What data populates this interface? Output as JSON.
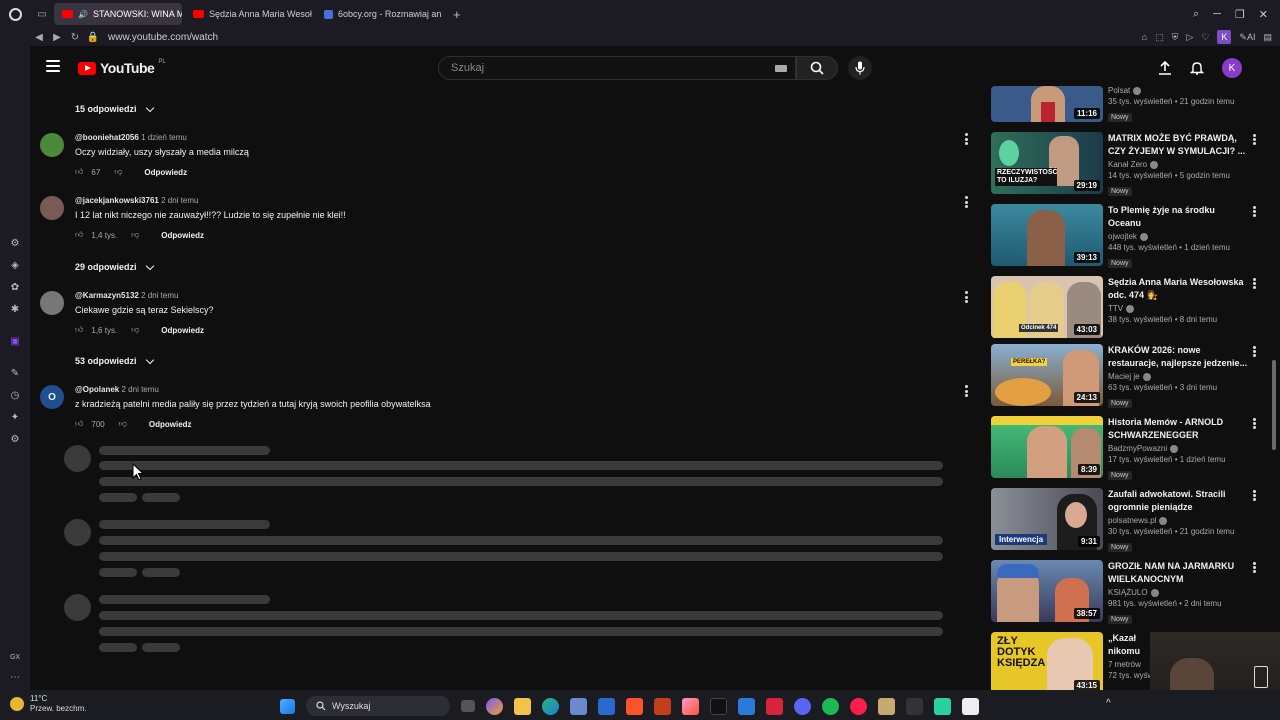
{
  "browser": {
    "tabs": [
      {
        "label": "STANOWSKI: WINA M",
        "active": true,
        "favicon_color": "#ff0000"
      },
      {
        "label": "Sędzia Anna Maria Wesoł",
        "active": false,
        "favicon_color": "#ff0000"
      },
      {
        "label": "6obcy.org - Rozmawiaj an",
        "active": false,
        "favicon_color": "#4a6fd8"
      }
    ],
    "url": "www.youtube.com/watch",
    "profile_letter": "K",
    "ai_label": "AI"
  },
  "header": {
    "logo_text": "YouTube",
    "region": "PL",
    "search_placeholder": "Szukaj",
    "avatar_letter": "K"
  },
  "comments": [
    {
      "replies_before": "15 odpowiedzi",
      "author": "@booniehat2056",
      "time": "1 dzień temu",
      "text": "Oczy widziały, uszy słyszały a media milczą",
      "likes": "67",
      "reply_label": "Odpowiedz",
      "avatar_color": "#4a8a3a"
    },
    {
      "author": "@jacekjankowski3761",
      "time": "2 dni temu",
      "text": "I 12 lat nikt niczego nie zauważył!!?? Ludzie to się zupełnie nie klei!!",
      "likes": "1,4 tys.",
      "reply_label": "Odpowiedz",
      "avatar_color": "#7a5a55"
    },
    {
      "replies_before": "29 odpowiedzi",
      "author": "@Karmazyn5132",
      "time": "2 dni temu",
      "text": "Ciekawe gdzie są teraz Sekielscy?",
      "likes": "1,6 tys.",
      "reply_label": "Odpowiedz",
      "avatar_color": "#777777"
    },
    {
      "replies_before": "53 odpowiedzi",
      "author": "@Opolanek",
      "time": "2 dni temu",
      "text": "z kradzieżą patelni media paliły się przez tydzień a tutaj kryją swoich peofilia obywatelksa",
      "likes": "700",
      "reply_label": "Odpowiedz",
      "avatar_color": "#1d4f91",
      "avatar_letter": "O"
    }
  ],
  "recommendations": [
    {
      "title": "",
      "channel": "Polsat",
      "views": "35 tys. wyświetleń • 21 godzin temu",
      "badge": "Nowy",
      "duration": "11:16",
      "thumb_color": "#3a5a8a"
    },
    {
      "title": "MATRIX MOŻE BYĆ PRAWDĄ, CZY ŻYJEMY W SYMULACJI? ...",
      "channel": "Kanał Zero",
      "views": "14 tys. wyświetleń • 5 godzin temu",
      "badge": "Nowy",
      "duration": "29:19",
      "thumb_color": "#2f6f5a",
      "thumb_text": "RZECZYWISTOŚĆ TO ILUZJA?"
    },
    {
      "title": "To Plemię żyje na środku Oceanu",
      "channel": "ojwojtek",
      "views": "448 tys. wyświetleń • 1 dzień temu",
      "badge": "Nowy",
      "duration": "39:13",
      "thumb_color": "#2a6e86"
    },
    {
      "title": "Sędzia Anna Maria Wesołowska odc. 474 👩‍⚖️",
      "channel": "TTV",
      "views": "38 tys. wyświetleń • 8 dni temu",
      "badge": "",
      "duration": "43:03",
      "thumb_color": "#c0a38a",
      "thumb_text": "Odcinek 474"
    },
    {
      "title": "KRAKÓW 2026: nowe restauracje, najlepsze jedzenie...",
      "channel": "Maciej je",
      "views": "63 tys. wyświetleń • 3 dni temu",
      "badge": "Nowy",
      "duration": "24:13",
      "thumb_color": "#8a6a4a",
      "thumb_text": "PEREŁKA?"
    },
    {
      "title": "Historia Memów - ARNOLD SCHWARZENEGGER",
      "channel": "BadzmyPowazni",
      "views": "17 tys. wyświetleń • 1 dzień temu",
      "badge": "Nowy",
      "duration": "8:39",
      "thumb_color": "#3aa86a"
    },
    {
      "title": "Zaufali adwokatowi. Stracili ogromnie pieniądze",
      "channel": "polsatnews.pl",
      "views": "30 tys. wyświetleń • 21 godzin temu",
      "badge": "Nowy",
      "duration": "9:31",
      "thumb_color": "#6a6f78",
      "thumb_text": "Interwencja"
    },
    {
      "title": "GROZIŁ NAM NA JARMARKU WIELKANOCNYM",
      "channel": "KSIĄŻULO",
      "views": "981 tys. wyświetleń • 2 dni temu",
      "badge": "Nowy",
      "duration": "38:57",
      "thumb_color": "#3a4a6a"
    },
    {
      "title": "„Kazał nikomu",
      "channel": "7 metrów",
      "views": "72 tys. wyśw",
      "badge": "",
      "duration": "43:15",
      "thumb_color": "#e7c628",
      "thumb_text": "ZŁY DOTYK KSIĘDZA"
    }
  ],
  "taskbar": {
    "temperature": "11°C",
    "weather": "Przew. bezchm.",
    "search_label": "Wyszukaj"
  },
  "gx_label": "GX"
}
